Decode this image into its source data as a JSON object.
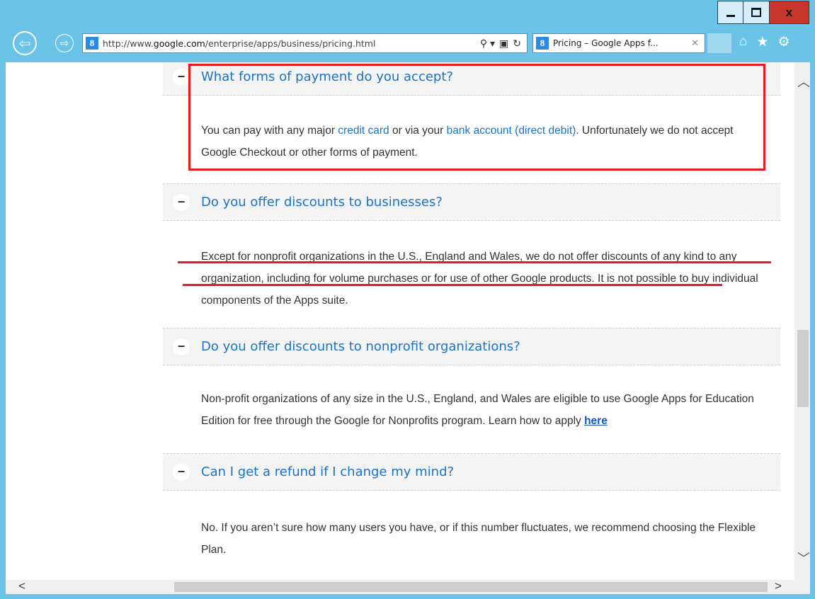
{
  "browser": {
    "url_prefix": "http://www.",
    "url_domain": "google.com",
    "url_path": "/enterprise/apps/business/pricing.html",
    "search_glyph": "⚲ ▾",
    "compat_glyph": "▣",
    "refresh_glyph": "↻",
    "tab_title": "Pricing – Google Apps f...",
    "tab_close": "✕",
    "favicon_letter": "8",
    "back_glyph": "⇦",
    "forward_glyph": "⇨",
    "home_glyph": "⌂",
    "favorites_glyph": "★",
    "settings_glyph": "⚙",
    "close_glyph": "x"
  },
  "faq": [
    {
      "question": "What forms of payment do you accept?",
      "answer_p1": "You can pay with any major ",
      "link1": "credit card",
      "answer_p2": " or via your ",
      "link2": "bank account (direct debit)",
      "answer_p3": ". Unfortunately we do not accept Google Checkout or other forms of payment."
    },
    {
      "question": "Do you offer discounts to businesses?",
      "answer": "Except for nonprofit organizations in the U.S., England and Wales, we do not offer discounts of any kind to any organization, including for volume purchases or for use of other Google products. It is not possible to buy individual components of the Apps suite."
    },
    {
      "question": "Do you offer discounts to nonprofit organizations?",
      "answer": "Non-profit organizations of any size in the U.S., England, and Wales are eligible to use Google Apps for Education Edition for free through the Google for Nonprofits program. Learn how to apply ",
      "link": "here"
    },
    {
      "question": "Can I get a refund if I change my mind?",
      "answer": "No. If you aren’t sure how many users you have, or if this number fluctuates, we recommend choosing the Flexible Plan."
    }
  ],
  "toggle_glyph": "−",
  "colors": {
    "link": "#1a73c8",
    "annotation": "#e51b24",
    "titlebar": "#6cc3e8",
    "close_button": "#c8362b"
  }
}
